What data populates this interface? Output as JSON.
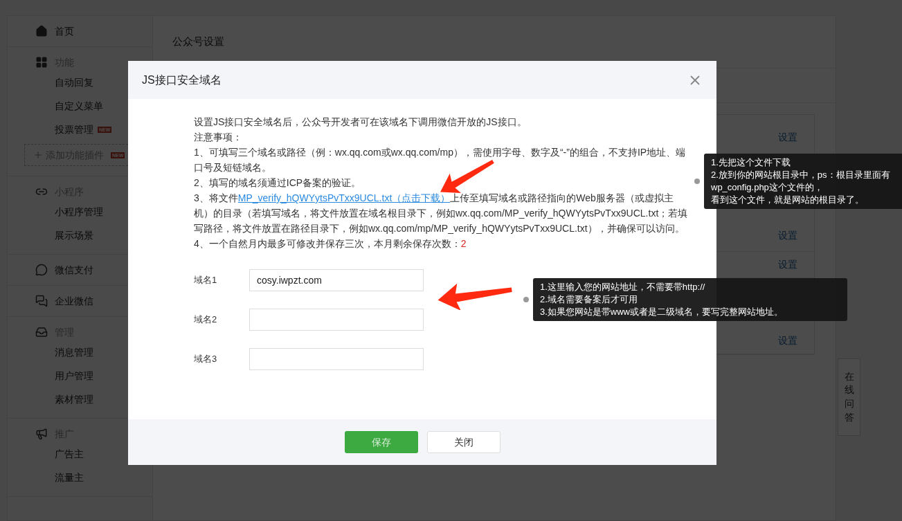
{
  "sidebar": [
    {
      "kind": "link",
      "label": "首页"
    },
    {
      "kind": "group",
      "label": "功能",
      "items": [
        {
          "label": "自动回复"
        },
        {
          "label": "自定义菜单"
        },
        {
          "label": "投票管理",
          "badge": "NEW"
        }
      ],
      "add_button": {
        "label": "添加功能插件",
        "badge": "NEW"
      }
    },
    {
      "kind": "group",
      "label": "小程序",
      "items": [
        {
          "label": "小程序管理"
        },
        {
          "label": "展示场景"
        }
      ]
    },
    {
      "kind": "link",
      "label": "微信支付"
    },
    {
      "kind": "link",
      "label": "企业微信"
    },
    {
      "kind": "group",
      "label": "管理",
      "items": [
        {
          "label": "消息管理"
        },
        {
          "label": "用户管理"
        },
        {
          "label": "素材管理"
        }
      ]
    },
    {
      "kind": "group",
      "label": "推广",
      "items": [
        {
          "label": "广告主"
        },
        {
          "label": "流量主"
        }
      ]
    }
  ],
  "content": {
    "title": "公众号设置",
    "settings_links": [
      "设置",
      "设置",
      "设置",
      "设置"
    ]
  },
  "help_tab": "在线问答",
  "dialog": {
    "title": "JS接口安全域名",
    "intro": "设置JS接口安全域名后，公众号开发者可在该域名下调用微信开放的JS接口。",
    "notes_heading": "注意事项：",
    "notes": [
      {
        "text": "1、可填写三个域名或路径（例：wx.qq.com或wx.qq.com/mp），需使用字母、数字及“-”的组合，不支持IP地址、端口号及短链域名。"
      },
      {
        "text": "2、填写的域名须通过ICP备案的验证。"
      },
      {
        "text": "3、将文件",
        "link": "MP_verify_hQWYytsPvTxx9UCL.txt（点击下载）",
        "after": "上传至填写域名或路径指向的Web服务器（或虚拟主机）的目录（若填写域名，将文件放置在域名根目录下，例如wx.qq.com/MP_verify_hQWYytsPvTxx9UCL.txt；若填写路径，将文件放置在路径目录下，例如wx.qq.com/mp/MP_verify_hQWYytsPvTxx9UCL.txt），并确保可以访问。"
      },
      {
        "text": "4、一个自然月内最多可修改并保存三次，本月剩余保存次数：",
        "count": "2"
      }
    ],
    "fields": [
      {
        "label": "域名1",
        "value": "cosy.iwpzt.com"
      },
      {
        "label": "域名2"
      },
      {
        "label": "域名3"
      }
    ],
    "buttons": [
      {
        "label": "保存",
        "kind": "primary"
      },
      {
        "label": "关闭",
        "kind": "default"
      }
    ]
  },
  "annotations": [
    {
      "lines": [
        "1.先把这个文件下载",
        "2.放到你的网站根目录中，ps：根目录里面有wp_config.php这个文件的，",
        "看到这个文件，就是网站的根目录了。"
      ]
    },
    {
      "lines": [
        "1.这里输入您的网站地址，不需要带http://",
        "2.域名需要备案后才可用",
        "3.如果您网站是带www或者是二级域名，要写完整网站地址。"
      ]
    }
  ]
}
